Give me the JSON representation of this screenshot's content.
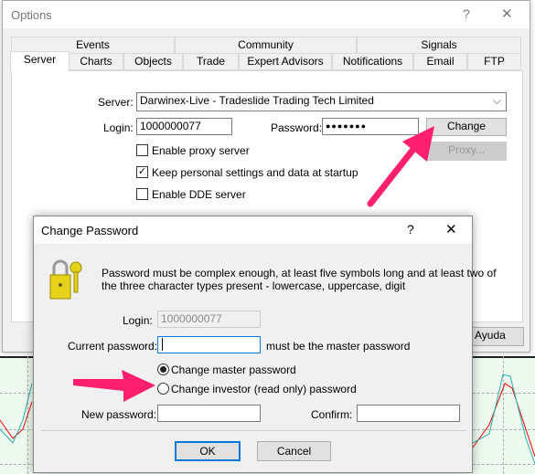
{
  "options": {
    "title": "Options",
    "help": "?",
    "close": "✕",
    "tabs_row1": [
      "Events",
      "Community",
      "Signals"
    ],
    "tabs_row2": [
      "Server",
      "Charts",
      "Objects",
      "Trade",
      "Expert Advisors",
      "Notifications",
      "Email",
      "FTP"
    ],
    "selected_tab": "Server",
    "server_label": "Server:",
    "server_value": "Darwinex-Live - Tradeslide Trading Tech Limited",
    "login_label": "Login:",
    "login_value": "1000000077",
    "password_label": "Password:",
    "password_value": "●●●●●●●",
    "change_button": "Change",
    "proxy_button": "Proxy...",
    "checkboxes": [
      {
        "label": "Enable proxy server",
        "checked": false
      },
      {
        "label": "Keep personal settings and data at startup",
        "checked": true
      },
      {
        "label": "Enable DDE server",
        "checked": false
      }
    ],
    "help_button": "Ayuda"
  },
  "change_password": {
    "title": "Change Password",
    "help": "?",
    "close": "✕",
    "icon": "lock-keys-icon",
    "message_line1": "Password must be complex enough, at least five symbols long and at least two of",
    "message_line2": "the three character types present - lowercase, uppercase, digit",
    "login_label": "Login:",
    "login_value": "1000000077",
    "current_label": "Current password:",
    "current_value": "",
    "current_hint": "must be the master password",
    "radio_master": "Change master password",
    "radio_investor": "Change investor (read only) password",
    "selected_radio": "master",
    "new_label": "New password:",
    "confirm_label": "Confirm:",
    "ok": "OK",
    "cancel": "Cancel"
  },
  "colors": {
    "annotation_arrow": "#ff1f6e",
    "focus": "#0078d7"
  }
}
